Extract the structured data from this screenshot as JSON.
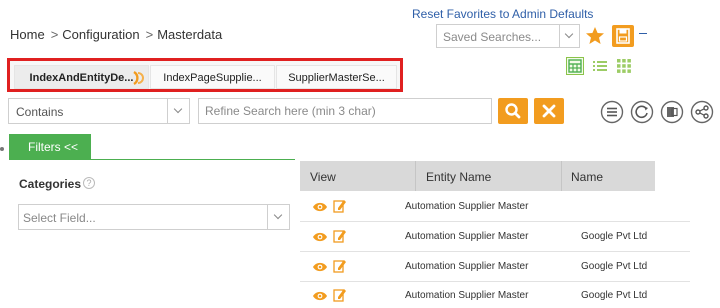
{
  "breadcrumb": {
    "items": [
      "Home",
      "Configuration",
      "Masterdata"
    ],
    "separator": ">"
  },
  "header": {
    "reset_link": "Reset Favorites to Admin Defaults",
    "saved_searches_placeholder": "Saved Searches..."
  },
  "tabs": [
    {
      "label": "IndexAndEntityDe...",
      "active": true
    },
    {
      "label": "IndexPageSupplie...",
      "active": false
    },
    {
      "label": "SupplierMasterSe...",
      "active": false
    }
  ],
  "search": {
    "match_mode": "Contains",
    "refine_placeholder": "Refine Search here (min 3 char)"
  },
  "filters": {
    "button_label": "Filters <<",
    "categories_label": "Categories",
    "select_placeholder": "Select Field..."
  },
  "table": {
    "columns": [
      "View",
      "Entity Name",
      "Name"
    ],
    "rows": [
      {
        "entity": "Automation Supplier Master",
        "name": ""
      },
      {
        "entity": "Automation Supplier Master",
        "name": "Google Pvt Ltd"
      },
      {
        "entity": "Automation Supplier Master",
        "name": "Google Pvt Ltd"
      },
      {
        "entity": "Automation Supplier Master",
        "name": "Google Pvt Ltd"
      }
    ]
  },
  "icons": [
    "star-icon",
    "save-icon",
    "grid-view-icon",
    "list-view-icon",
    "tile-view-icon",
    "search-icon",
    "clear-icon",
    "list-circle-icon",
    "refresh-circle-icon",
    "export-circle-icon",
    "share-circle-icon",
    "eye-icon",
    "edit-icon",
    "help-icon"
  ],
  "colors": {
    "accent_orange": "#f29c1f",
    "filters_green": "#4caf50",
    "highlight_red": "#e02020",
    "link_blue": "#2f5fa8"
  }
}
